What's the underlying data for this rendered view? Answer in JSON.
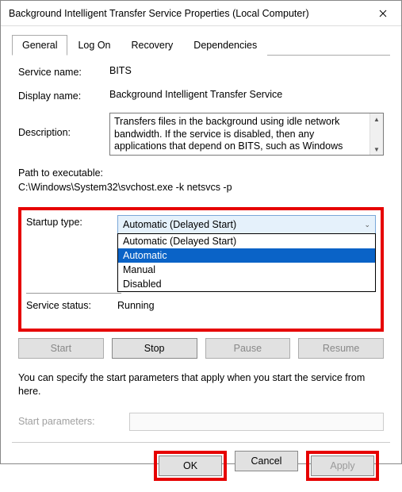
{
  "window": {
    "title": "Background Intelligent Transfer Service Properties (Local Computer)"
  },
  "tabs": {
    "general": "General",
    "logon": "Log On",
    "recovery": "Recovery",
    "dependencies": "Dependencies"
  },
  "fields": {
    "service_name_label": "Service name:",
    "service_name_value": "BITS",
    "display_name_label": "Display name:",
    "display_name_value": "Background Intelligent Transfer Service",
    "description_label": "Description:",
    "description_value": "Transfers files in the background using idle network bandwidth. If the service is disabled, then any applications that depend on BITS, such as Windows",
    "path_label": "Path to executable:",
    "path_value": "C:\\Windows\\System32\\svchost.exe -k netsvcs -p",
    "startup_label": "Startup type:",
    "startup_selected": "Automatic (Delayed Start)",
    "startup_options": {
      "0": "Automatic (Delayed Start)",
      "1": "Automatic",
      "2": "Manual",
      "3": "Disabled"
    },
    "status_label": "Service status:",
    "status_value": "Running"
  },
  "buttons": {
    "start": "Start",
    "stop": "Stop",
    "pause": "Pause",
    "resume": "Resume"
  },
  "note": "You can specify the start parameters that apply when you start the service from here.",
  "start_params": {
    "label": "Start parameters:",
    "value": ""
  },
  "footer": {
    "ok": "OK",
    "cancel": "Cancel",
    "apply": "Apply"
  }
}
